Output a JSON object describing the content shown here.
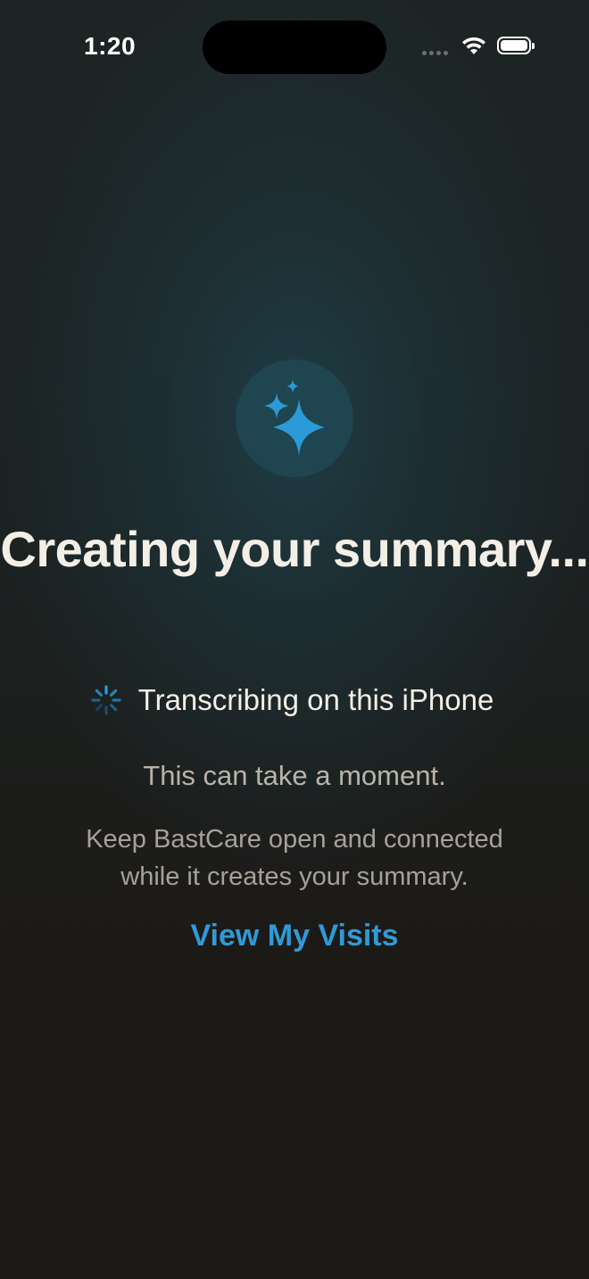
{
  "status_bar": {
    "time": "1:20"
  },
  "colors": {
    "accent": "#2f9ad6",
    "background": "#1c1a17",
    "title_text": "#f4efe6"
  },
  "hero": {
    "icon": "sparkles-icon",
    "title": "Creating your summary..."
  },
  "progress": {
    "icon": "activity-spinner-icon",
    "label": "Transcribing on this iPhone"
  },
  "messages": {
    "moment": "This can take a moment.",
    "keep_open": "Keep BastCare open and connected while it creates your summary."
  },
  "actions": {
    "view_visits_label": "View My Visits"
  }
}
